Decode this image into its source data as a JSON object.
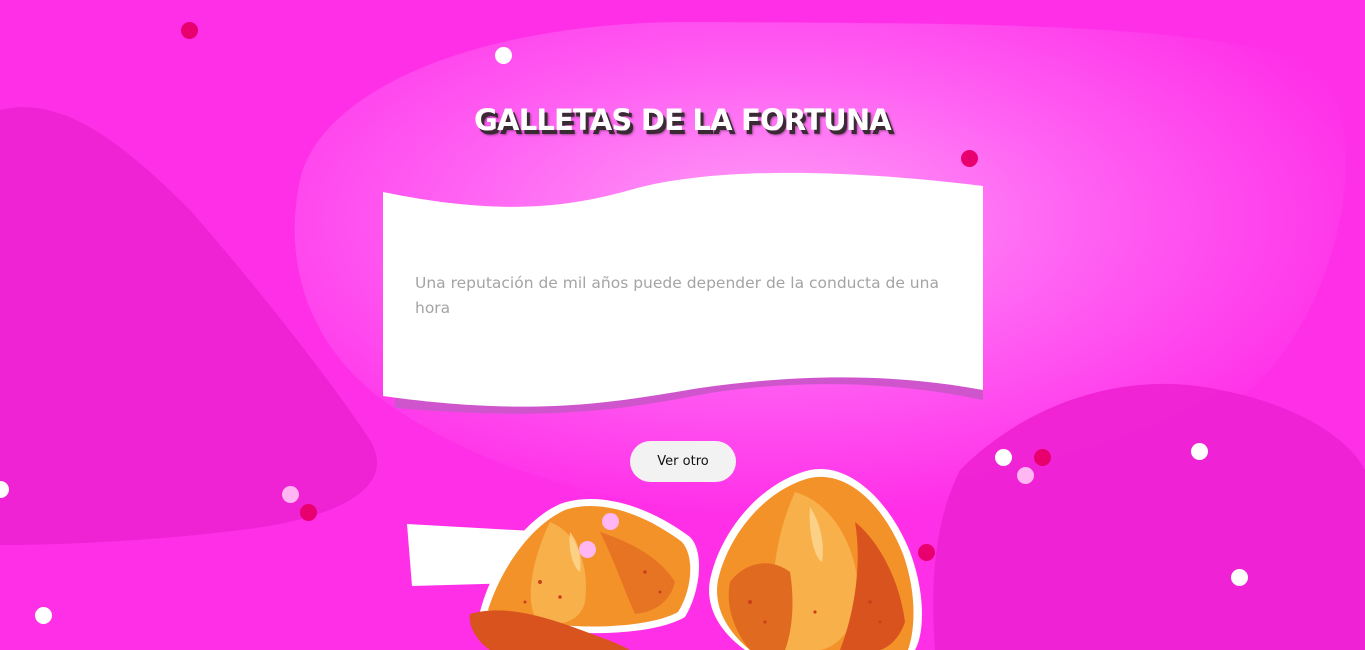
{
  "page": {
    "title": "GALLETAS DE LA FORTUNA"
  },
  "fortune": {
    "message": "Una reputación de mil años puede depender de la conducta de una hora"
  },
  "actions": {
    "next_label": "Ver otro"
  },
  "colors": {
    "background": "#ff2fe8",
    "card": "#ffffff",
    "card_shadow": "#c84fc8",
    "text_muted": "#a4a4a4",
    "button_bg": "#f2f2f2",
    "dot_pink": "#e8006f"
  },
  "illustration": {
    "icon": "fortune-cookies-icon"
  }
}
